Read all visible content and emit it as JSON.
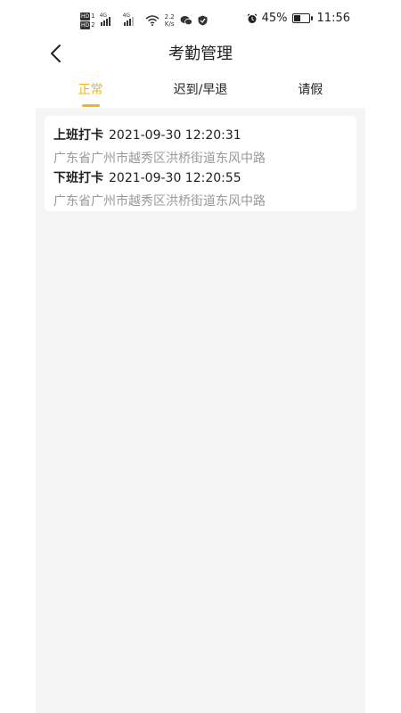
{
  "status": {
    "hd_top": "HD",
    "hd_top_num": "1",
    "hd_bottom": "HD",
    "hd_bottom_num": "2",
    "net1": "4G",
    "net2": "4G",
    "speed_value": "2.2",
    "speed_unit": "K/s",
    "battery_pct": "45%",
    "battery_fill": 0.45,
    "time": "11:56"
  },
  "header": {
    "title": "考勤管理"
  },
  "tabs": [
    {
      "label": "正常",
      "active": true
    },
    {
      "label": "迟到/早退",
      "active": false
    },
    {
      "label": "请假",
      "active": false
    }
  ],
  "records": [
    {
      "kind": "上班打卡",
      "datetime": "2021-09-30 12:20:31",
      "address": "广东省广州市越秀区洪桥街道东风中路"
    },
    {
      "kind": "下班打卡",
      "datetime": "2021-09-30 12:20:55",
      "address": "广东省广州市越秀区洪桥街道东风中路"
    }
  ],
  "colors": {
    "accent": "#f3b418",
    "content_bg": "#f5f5f5",
    "muted_text": "#999999"
  }
}
